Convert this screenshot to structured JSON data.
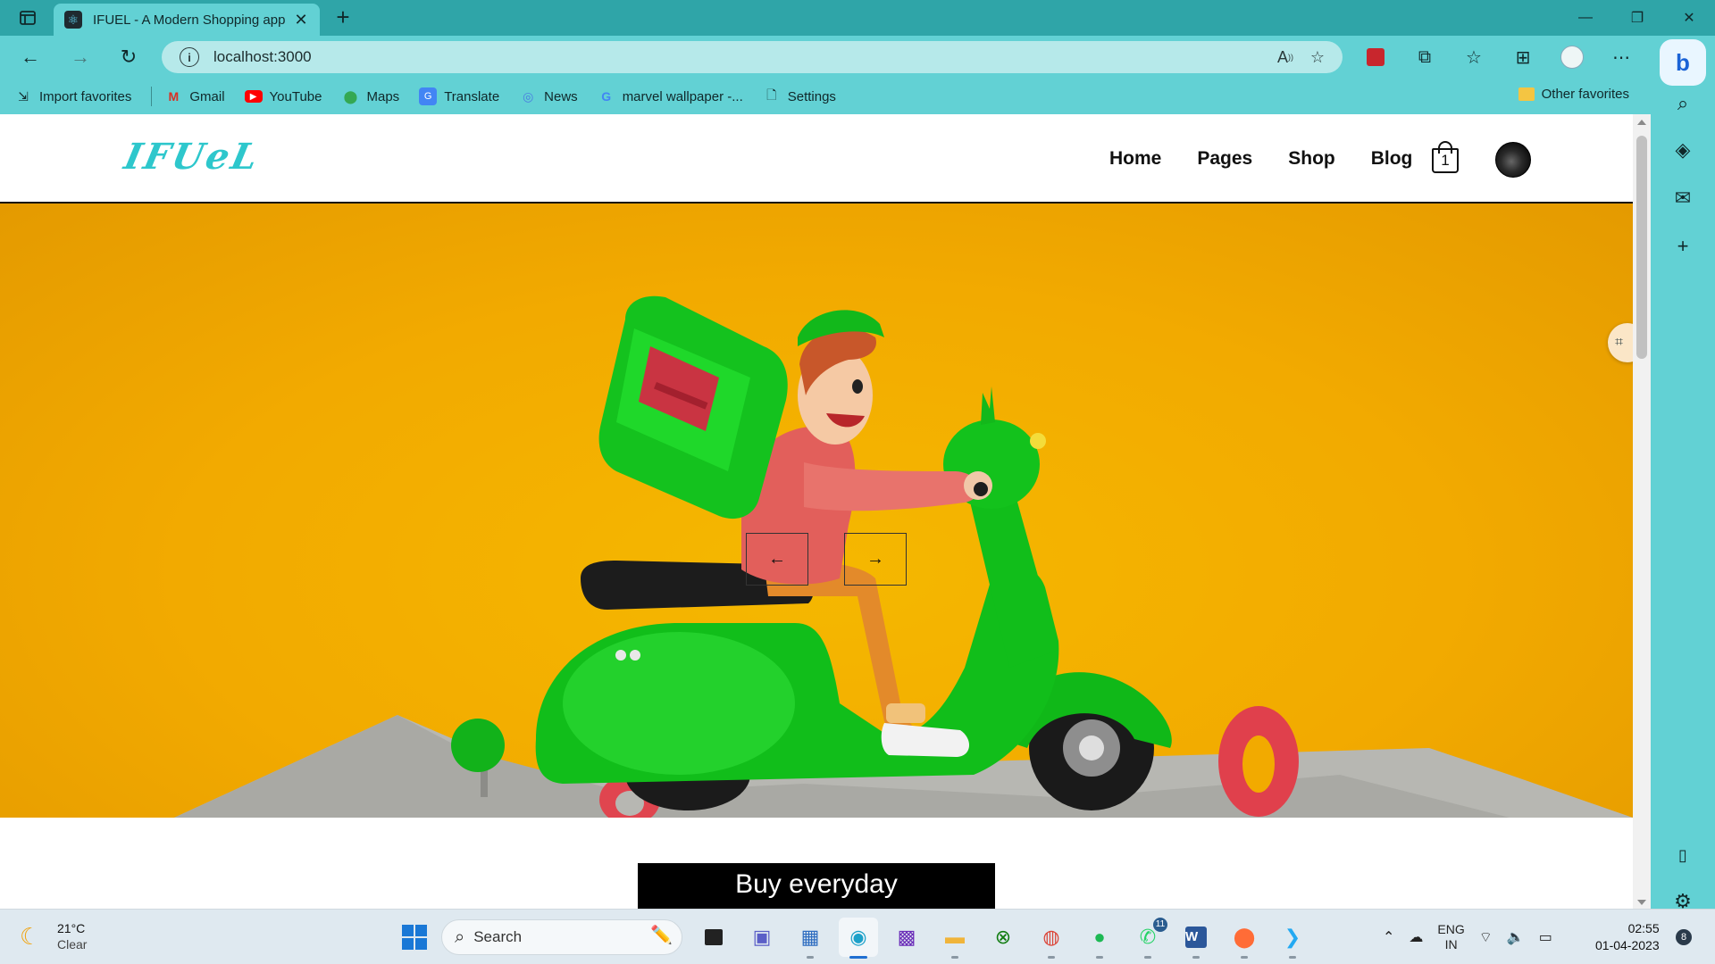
{
  "browser": {
    "tab_title": "IFUEL - A Modern Shopping app",
    "url": "localhost:3000",
    "bookmarks": [
      {
        "label": "Import favorites",
        "icon": "import-icon"
      },
      {
        "label": "Gmail",
        "icon": "gmail-icon"
      },
      {
        "label": "YouTube",
        "icon": "youtube-icon"
      },
      {
        "label": "Maps",
        "icon": "maps-icon"
      },
      {
        "label": "Translate",
        "icon": "translate-icon"
      },
      {
        "label": "News",
        "icon": "news-icon"
      },
      {
        "label": "marvel wallpaper -...",
        "icon": "google-icon"
      },
      {
        "label": "Settings",
        "icon": "page-icon"
      }
    ],
    "other_favorites": "Other favorites"
  },
  "site": {
    "logo": "IFUeL",
    "nav": [
      "Home",
      "Pages",
      "Shop",
      "Blog"
    ],
    "cart_count": "1",
    "slider_prev": "←",
    "slider_next": "→",
    "cta": "Buy everyday"
  },
  "taskbar": {
    "weather_temp": "21°C",
    "weather_cond": "Clear",
    "search_placeholder": "Search",
    "whatsapp_badge": "11",
    "lang_line1": "ENG",
    "lang_line2": "IN",
    "time": "02:55",
    "date": "01-04-2023",
    "notifications": "8"
  },
  "colors": {
    "chrome_accent": "#62d1d4",
    "titlebar": "#2fa5a8",
    "hero_bg": "#f2aa00",
    "logo": "#2ec7cc",
    "scooter_green": "#14c11c"
  }
}
